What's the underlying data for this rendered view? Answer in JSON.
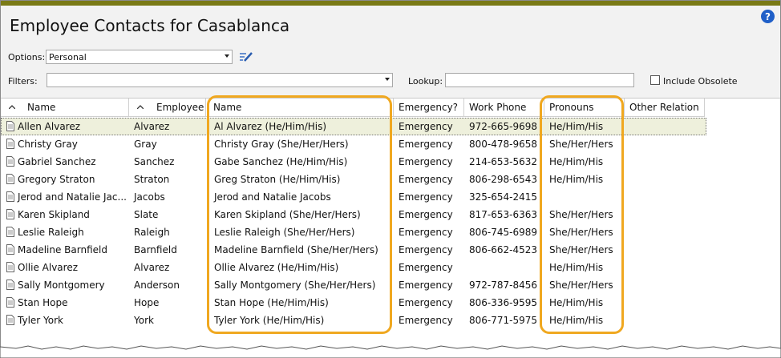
{
  "window": {
    "title": "Employee Contacts for Casablanca",
    "help_icon": "?"
  },
  "options": {
    "label": "Options:",
    "value": "Personal"
  },
  "filters": {
    "label": "Filters:",
    "value": ""
  },
  "lookup": {
    "label": "Lookup:",
    "value": ""
  },
  "include_obsolete": {
    "label": "Include Obsolete",
    "checked": false
  },
  "columns": {
    "name": "Name",
    "employee": "Employee",
    "contact_name": "Name",
    "emergency": "Emergency?",
    "work_phone": "Work Phone",
    "pronouns": "Pronouns",
    "other_relation": "Other Relation"
  },
  "rows": [
    {
      "name": "Allen Alvarez",
      "employee": "Alvarez",
      "contact_name": "Al Alvarez  (He/Him/His)",
      "emergency": "Emergency",
      "work_phone": "972-665-9698",
      "pronouns": "He/Him/His",
      "other_relation": ""
    },
    {
      "name": "Christy Gray",
      "employee": "Gray",
      "contact_name": "Christy Gray  (She/Her/Hers)",
      "emergency": "Emergency",
      "work_phone": "800-478-9658",
      "pronouns": "She/Her/Hers",
      "other_relation": ""
    },
    {
      "name": "Gabriel Sanchez",
      "employee": "Sanchez",
      "contact_name": "Gabe Sanchez  (He/Him/His)",
      "emergency": "Emergency",
      "work_phone": "214-653-5632",
      "pronouns": "He/Him/His",
      "other_relation": ""
    },
    {
      "name": "Gregory Straton",
      "employee": "Straton",
      "contact_name": "Greg Straton  (He/Him/His)",
      "emergency": "Emergency",
      "work_phone": "806-298-6543",
      "pronouns": "He/Him/His",
      "other_relation": ""
    },
    {
      "name": "Jerod and Natalie Jac...",
      "employee": "Jacobs",
      "contact_name": "Jerod and Natalie Jacobs",
      "emergency": "Emergency",
      "work_phone": "325-654-2415",
      "pronouns": "",
      "other_relation": ""
    },
    {
      "name": "Karen Skipland",
      "employee": "Slate",
      "contact_name": "Karen Skipland  (She/Her/Hers)",
      "emergency": "Emergency",
      "work_phone": "817-653-6363",
      "pronouns": "She/Her/Hers",
      "other_relation": ""
    },
    {
      "name": "Leslie Raleigh",
      "employee": "Raleigh",
      "contact_name": "Leslie Raleigh  (She/Her/Hers)",
      "emergency": "Emergency",
      "work_phone": "806-745-6989",
      "pronouns": "She/Her/Hers",
      "other_relation": ""
    },
    {
      "name": "Madeline Barnfield",
      "employee": "Barnfield",
      "contact_name": "Madeline Barnfield  (She/Her/Hers)",
      "emergency": "Emergency",
      "work_phone": "806-662-4523",
      "pronouns": "She/Her/Hers",
      "other_relation": ""
    },
    {
      "name": "Ollie Alvarez",
      "employee": "Alvarez",
      "contact_name": "Ollie Alvarez  (He/Him/His)",
      "emergency": "Emergency",
      "work_phone": "",
      "pronouns": "He/Him/His",
      "other_relation": ""
    },
    {
      "name": "Sally Montgomery",
      "employee": "Anderson",
      "contact_name": "Sally Montgomery  (She/Her/Hers)",
      "emergency": "Emergency",
      "work_phone": "972-787-8456",
      "pronouns": "She/Her/Hers",
      "other_relation": ""
    },
    {
      "name": "Stan Hope",
      "employee": "Hope",
      "contact_name": "Stan Hope  (He/Him/His)",
      "emergency": "Emergency",
      "work_phone": "806-336-9595",
      "pronouns": "He/Him/His",
      "other_relation": ""
    },
    {
      "name": "Tyler York",
      "employee": "York",
      "contact_name": "Tyler York  (He/Him/His)",
      "emergency": "Emergency",
      "work_phone": "806-771-5975",
      "pronouns": "He/Him/His",
      "other_relation": ""
    }
  ],
  "colors": {
    "highlight": "#f0a820",
    "title_bar": "#7a7a16",
    "selected_row": "#eef0dc"
  }
}
